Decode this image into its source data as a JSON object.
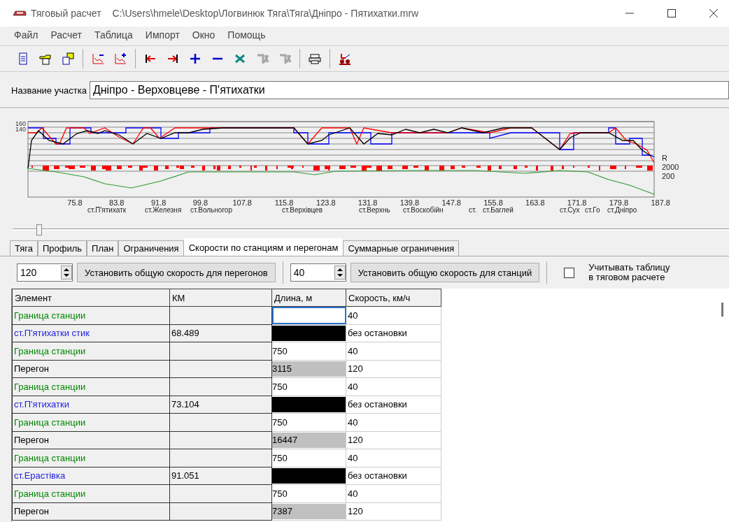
{
  "window": {
    "title": "Тяговый расчет",
    "path": "C:\\Users\\hmele\\Desktop\\Логвинюк Тяга\\Тяга\\Дніпро - Пятихатки.mrw"
  },
  "menu": [
    "Файл",
    "Расчет",
    "Таблица",
    "Импорт",
    "Окно",
    "Помощь"
  ],
  "toolbar": [
    [
      {
        "disabled": false
      },
      {
        "disabled": false
      },
      {
        "disabled": false
      }
    ],
    [
      {
        "disabled": false
      },
      {
        "disabled": false
      }
    ],
    [
      {
        "disabled": false
      },
      {
        "disabled": false
      },
      {
        "disabled": false
      },
      {
        "disabled": false
      },
      {
        "disabled": false
      },
      {
        "disabled": true
      },
      {
        "disabled": true
      }
    ],
    [
      {
        "disabled": false
      }
    ],
    [
      {
        "disabled": false
      }
    ]
  ],
  "section": {
    "label": "Название участка",
    "value": "Дніпро - Верховцеве - П'ятихатки"
  },
  "profile": {
    "y_labels": [
      "160",
      "140"
    ],
    "right_labels": [
      "R",
      "2000",
      "200"
    ],
    "x_labels": [
      "75.8",
      "83.8",
      "91.8",
      "99.8",
      "107.8",
      "115.8",
      "123.8",
      "131.8",
      "139.8",
      "147.8",
      "155.8",
      "163.8",
      "171.8",
      "179.8",
      "187.8"
    ],
    "stations": [
      "ст.П'ятихатк",
      "ст.Железня",
      "ст.Вольногор",
      "ст.Верхівцев",
      "ст.Верхнь",
      "ст.Воскобійн",
      "ст.",
      "ст.Баглей",
      "ст.Сух",
      "ст.Го",
      "ст.Дніпро"
    ]
  },
  "tabs": [
    {
      "label": "Тяга",
      "selected": false
    },
    {
      "label": "Профиль",
      "selected": false
    },
    {
      "label": "План",
      "selected": false
    },
    {
      "label": "Ограничения",
      "selected": false
    },
    {
      "label": "Скорости по станциям и перегонам",
      "selected": true
    },
    {
      "label": "Суммарные ограничения",
      "selected": false
    }
  ],
  "controls": {
    "stage_speed": "120",
    "stage_button": "Установить общую скорость для перегонов",
    "station_speed": "40",
    "station_button": "Установить общую скорость для станций",
    "use_table": {
      "label": "Учитывать таблицу\nв тяговом расчете",
      "checked": false
    }
  },
  "table": {
    "columns": [
      "Элемент",
      "КМ",
      "Длина, м",
      "Скорость, км/ч"
    ],
    "rows": [
      {
        "kind": "boundary",
        "element": "Граница станции",
        "length": "",
        "speed": "40",
        "selected": true
      },
      {
        "kind": "station",
        "element": "ст.П'ятихатки стик",
        "km": "68.489",
        "speed": "без остановки",
        "selected": false
      },
      {
        "kind": "boundary",
        "element": "Граница станции",
        "length": "750",
        "speed": "40",
        "selected": false
      },
      {
        "kind": "stage",
        "element": "Перегон",
        "length": "3115",
        "speed": "120",
        "selected": false
      },
      {
        "kind": "boundary",
        "element": "Граница станции",
        "length": "750",
        "speed": "40",
        "selected": false
      },
      {
        "kind": "station",
        "element": "ст.П'ятихатки",
        "km": "73.104",
        "speed": "без остановки",
        "selected": false
      },
      {
        "kind": "boundary",
        "element": "Граница станции",
        "length": "750",
        "speed": "40",
        "selected": false
      },
      {
        "kind": "stage",
        "element": "Перегон",
        "length": "16447",
        "speed": "120",
        "selected": false
      },
      {
        "kind": "boundary",
        "element": "Граница станции",
        "length": "750",
        "speed": "40",
        "selected": false
      },
      {
        "kind": "station",
        "element": "ст.Ерастівка",
        "km": "91.051",
        "speed": "без остановки",
        "selected": false
      },
      {
        "kind": "boundary",
        "element": "Граница станции",
        "length": "750",
        "speed": "40",
        "selected": false
      },
      {
        "kind": "stage",
        "element": "Перегон",
        "length": "7387",
        "speed": "120",
        "selected": false
      }
    ]
  }
}
